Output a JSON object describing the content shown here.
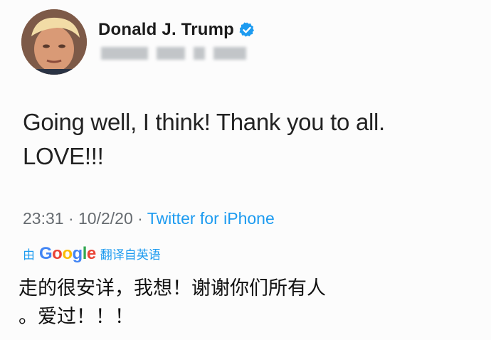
{
  "author": {
    "name": "Donald J. Trump",
    "verified_icon": "verified-badge-icon",
    "avatar_icon": "avatar-photo"
  },
  "tweet": {
    "line1": "Going well, I think! Thank you to all.",
    "line2": "LOVE!!!"
  },
  "meta": {
    "time": "23:31",
    "sep1": " · ",
    "date": "10/2/20",
    "sep2": " · ",
    "source": "Twitter for iPhone"
  },
  "translation": {
    "by_label": "由",
    "google_letters": [
      "G",
      "o",
      "o",
      "g",
      "l",
      "e"
    ],
    "google_colors": [
      "#4285F4",
      "#EA4335",
      "#FBBC05",
      "#4285F4",
      "#34A853",
      "#EA4335"
    ],
    "from_label": "翻译自英语",
    "line1": "走的很安详，我想！谢谢你们所有人",
    "line2": "。爱过！！！"
  },
  "colors": {
    "accent": "#1d9bf0",
    "text": "#222222",
    "muted": "#666b70"
  }
}
